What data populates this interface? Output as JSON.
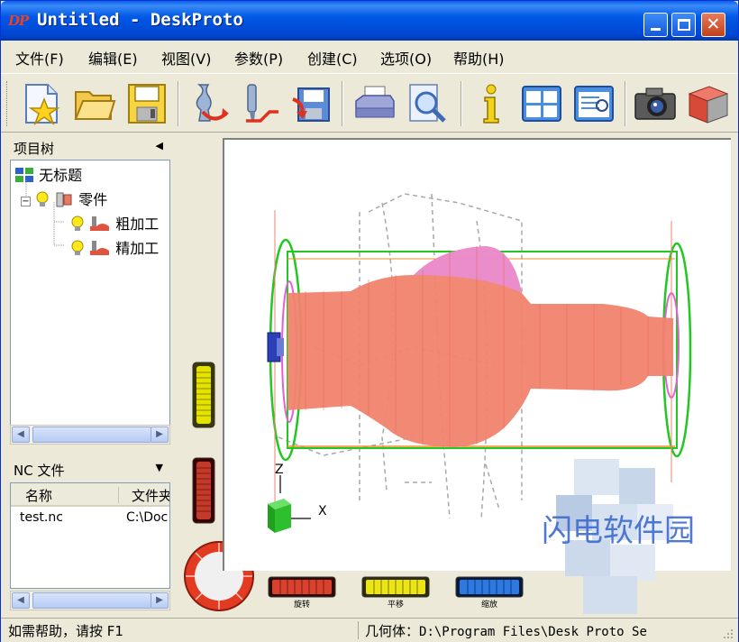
{
  "window": {
    "app_icon": "DP",
    "title": "Untitled - DeskProto"
  },
  "menu": [
    "文件(F)",
    "编辑(E)",
    "视图(V)",
    "参数(P)",
    "创建(C)",
    "选项(O)",
    "帮助(H)"
  ],
  "toolbar": {
    "icons": [
      "new-icon",
      "open-folder-icon",
      "save-icon",
      "roughing-toolpath-icon",
      "finishing-toolpath-icon",
      "save-nc-icon",
      "print-icon",
      "print-preview-icon",
      "info-icon",
      "window-layout-icon",
      "list-view-icon",
      "camera-icon",
      "render-cube-icon"
    ]
  },
  "tree_pane": {
    "title": "项目树",
    "items": [
      {
        "label": "无标题",
        "icon": "project-icon"
      },
      {
        "label": "零件",
        "icon": "part-icon"
      },
      {
        "label": "粗加工",
        "icon": "operation-icon"
      },
      {
        "label": "精加工",
        "icon": "operation-icon"
      }
    ]
  },
  "nc_pane": {
    "title": "NC 文件",
    "columns": [
      "名称",
      "文件夹"
    ],
    "rows": [
      {
        "name": "test.nc",
        "folder": "C:\\Doc"
      }
    ]
  },
  "view": {
    "axis_z": "Z",
    "axis_x": "X",
    "wheels": {
      "rotate": "旋转",
      "pan": "平移",
      "zoom": "缩放"
    }
  },
  "status": {
    "help": "如需帮助，请按 F1",
    "geometry_label": "几何体：",
    "geometry_path": "D:\\Program Files\\Desk Proto Se"
  },
  "watermark": "闪电软件园",
  "colors": {
    "title_blue": "#0054E3",
    "toolpath": "#F0836E",
    "bounding_green": "#22C722",
    "bounding_orange": "#F28C28",
    "accent_magenta": "#E060D8"
  }
}
